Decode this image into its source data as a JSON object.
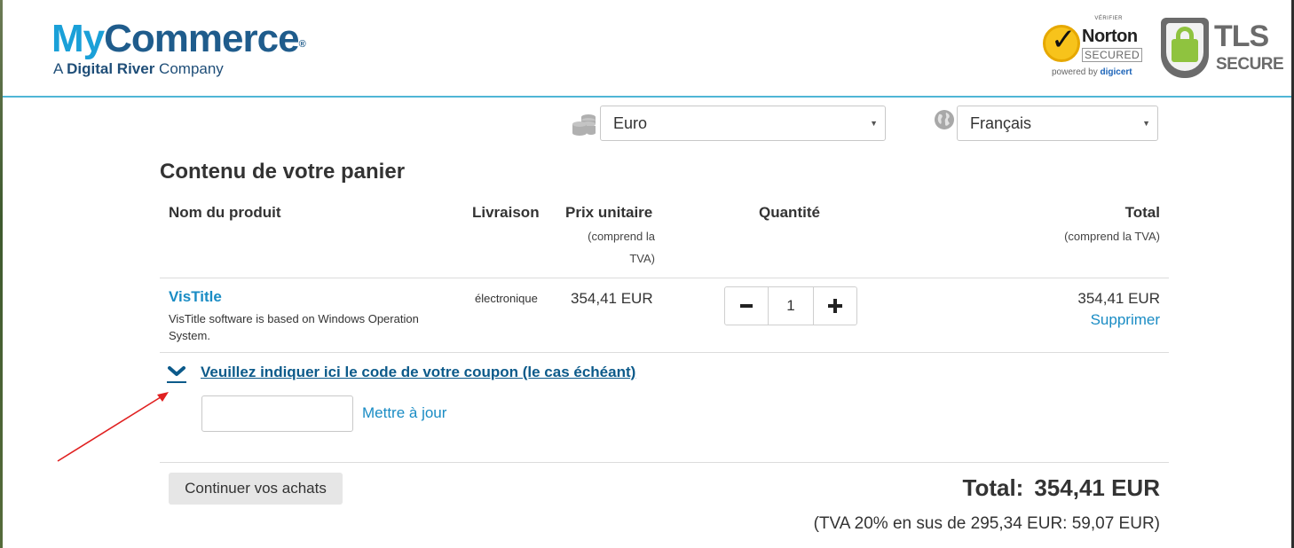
{
  "header": {
    "logo_main_my": "My",
    "logo_main_commerce": "Commerce",
    "logo_reg": "®",
    "logo_sub_prefix": "A ",
    "logo_sub_bold": "Digital River",
    "logo_sub_suffix": " Company",
    "norton": {
      "verify": "VÉRIFIER",
      "name": "Norton",
      "secured": "SECURED",
      "powered": "powered by ",
      "brand": "digicert"
    },
    "tls": {
      "title": "TLS",
      "subtitle": "SECURE"
    }
  },
  "selectors": {
    "currency": "Euro",
    "language": "Français"
  },
  "cart": {
    "title": "Contenu de votre panier",
    "columns": {
      "product": "Nom du produit",
      "delivery": "Livraison",
      "unit_price": "Prix unitaire",
      "unit_price_note_1": "(comprend la",
      "unit_price_note_2": "TVA)",
      "quantity": "Quantité",
      "total": "Total",
      "total_note": "(comprend la TVA)"
    },
    "item": {
      "name": "VisTitle",
      "description": "VisTitle software is based on Windows Operation System.",
      "delivery": "électronique",
      "unit_price": "354,41 EUR",
      "quantity": "1",
      "line_total": "354,41 EUR",
      "remove": "Supprimer"
    },
    "coupon": {
      "link": "Veuillez indiquer ici le code de votre coupon (le cas échéant)",
      "value": "",
      "update": "Mettre à jour"
    },
    "continue_button": "Continuer vos achats",
    "grand_total_label": "Total:",
    "grand_total_value": "354,41 EUR",
    "vat_note": "(TVA 20% en sus de 295,34 EUR: 59,07 EUR)"
  },
  "colors": {
    "accent": "#1a8cc4",
    "link_dark": "#0c5a8a",
    "header_rule": "#4fb6d6",
    "annotation_arrow": "#e02020"
  },
  "icons": [
    "coins-icon",
    "globe-icon",
    "minus-icon",
    "plus-icon",
    "chevron-down-icon",
    "annotation-arrow"
  ]
}
